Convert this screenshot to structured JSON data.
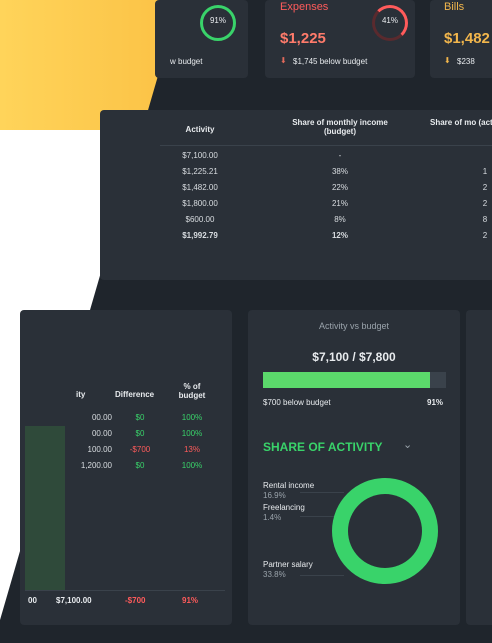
{
  "colors": {
    "accent_green": "#39d36a",
    "accent_red": "#ff5b5b",
    "accent_gold": "#f2b64c",
    "background": "#1f252c",
    "panel": "#2a3038",
    "yellow": "#f9c23d"
  },
  "kpi": {
    "income": {
      "percent": "91%",
      "note": "w budget"
    },
    "expenses": {
      "label": "Expenses",
      "amount": "$1,225",
      "percent": "41%",
      "note": "$1,745 below budget"
    },
    "bills": {
      "label": "Bills",
      "amount": "$1,482",
      "note": "$238"
    }
  },
  "activity_table": {
    "headers": [
      "Activity",
      "Share of monthly income (budget)",
      "Share of mo (act"
    ],
    "rows": [
      [
        "$7,100.00",
        "-",
        ""
      ],
      [
        "$1,225.21",
        "38%",
        "1"
      ],
      [
        "$1,482.00",
        "22%",
        "2"
      ],
      [
        "$1,800.00",
        "21%",
        "2"
      ],
      [
        "$600.00",
        "8%",
        "8"
      ],
      [
        "$1,992.79",
        "12%",
        "2"
      ]
    ]
  },
  "income_table": {
    "headers": [
      "ity",
      "Difference",
      "% of budget"
    ],
    "rows": [
      [
        "00.00",
        "$0",
        "100%"
      ],
      [
        "00.00",
        "$0",
        "100%"
      ],
      [
        "100.00",
        "-$700",
        "13%"
      ],
      [
        "1,200.00",
        "$0",
        "100%"
      ]
    ],
    "footer": [
      "00",
      "$7,100.00",
      "-$700",
      "91%"
    ]
  },
  "activity_vs_budget": {
    "title": "Activity vs budget",
    "value": "$7,100 / $7,800",
    "progress": 0.91,
    "below": "$700 below budget",
    "percent": "91%"
  },
  "share_of_activity": {
    "title": "SHARE OF ACTIVITY",
    "items": [
      {
        "label": "Rental income",
        "value": "16.9%"
      },
      {
        "label": "Freelancing",
        "value": "1.4%"
      },
      {
        "label": "Partner salary",
        "value": "33.8%"
      }
    ]
  }
}
